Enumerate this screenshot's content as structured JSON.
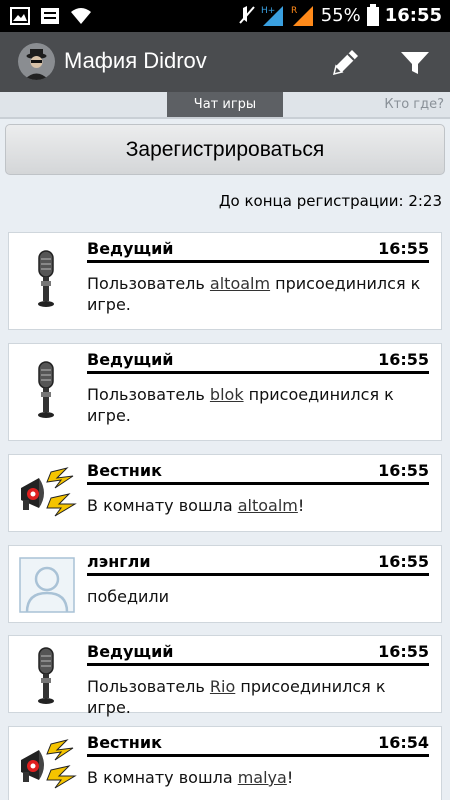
{
  "status_bar": {
    "battery": "55%",
    "time": "16:55",
    "icons": [
      "image-icon",
      "notification-icon",
      "wifi-icon",
      "mute-icon",
      "signal-h-icon",
      "signal-r-icon",
      "battery-icon"
    ]
  },
  "header": {
    "title": "Мафия Didrov",
    "actions": [
      "pencil-icon",
      "filter-icon"
    ]
  },
  "tabs": {
    "active": "Чат игры",
    "other": "Кто где?"
  },
  "register_button": "Зарегистрироваться",
  "countdown": "До конца регистрации: 2:23",
  "messages": [
    {
      "author": "Ведущий",
      "time": "16:55",
      "icon": "microphone-icon",
      "pre": "Пользователь ",
      "user": "altoalm",
      "post": " присоединился к игре."
    },
    {
      "author": "Ведущий",
      "time": "16:55",
      "icon": "microphone-icon",
      "pre": "Пользователь ",
      "user": "blok",
      "post": " присоединился к игре."
    },
    {
      "author": "Вестник",
      "time": "16:55",
      "icon": "megaphone-icon",
      "pre": "В комнату вошла ",
      "user": "altoalm",
      "post": "!"
    },
    {
      "author": "лэнгли",
      "time": "16:55",
      "icon": "default-avatar-icon",
      "pre": "победили",
      "user": "",
      "post": ""
    },
    {
      "author": "Ведущий",
      "time": "16:55",
      "icon": "microphone-icon",
      "pre": "Пользователь ",
      "user": "Rio",
      "post": " присоединился к игре."
    },
    {
      "author": "Вестник",
      "time": "16:54",
      "icon": "megaphone-icon",
      "pre": "В комнату вошла ",
      "user": "malya",
      "post": "!"
    }
  ],
  "colors": {
    "action_bar": "#4a4c4f",
    "background": "#e9eef3",
    "tab_active": "#5d6064"
  }
}
